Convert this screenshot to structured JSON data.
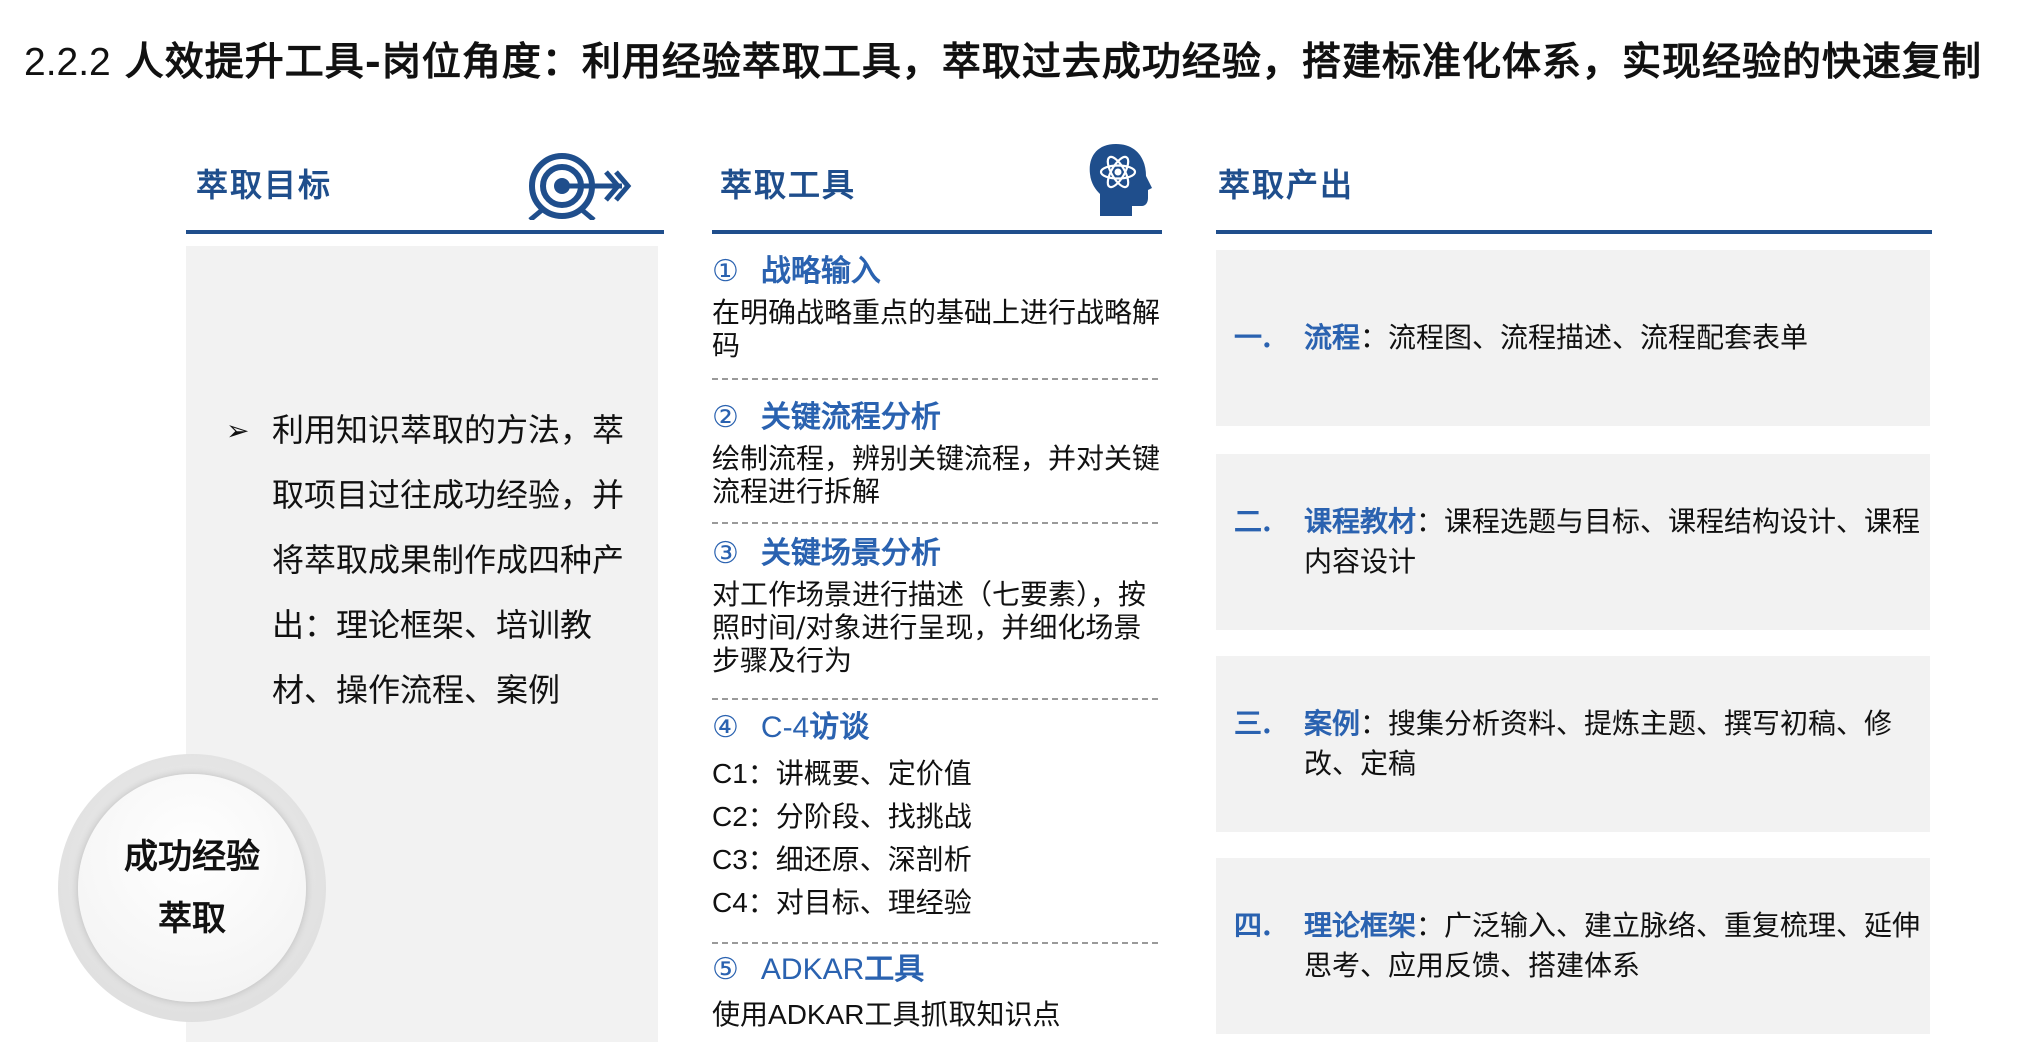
{
  "title": {
    "number": "2.2.2",
    "text": "人效提升工具-岗位角度：利用经验萃取工具，萃取过去成功经验，搭建标准化体系，实现经验的快速复制"
  },
  "columns": {
    "goal": {
      "heading": "萃取目标",
      "icon": "target-arrow-icon"
    },
    "tools": {
      "heading": "萃取工具",
      "icon": "brain-atom-icon"
    },
    "outputs": {
      "heading": "萃取产出"
    }
  },
  "goal_panel": {
    "bullet": "➢",
    "text": "利用知识萃取的方法，萃取项目过往成功经验，并将萃取成果制作成四种产出：理论框架、培训教材、操作流程、案例",
    "circle_line1": "成功经验",
    "circle_line2": "萃取"
  },
  "tools": [
    {
      "index": "①",
      "name": "战略输入",
      "desc": "在明确战略重点的基础上进行战略解码"
    },
    {
      "index": "②",
      "name": "关键流程分析",
      "desc": "绘制流程，辨别关键流程，并对关键流程进行拆解"
    },
    {
      "index": "③",
      "name": "关键场景分析",
      "desc": "对工作场景进行描述（七要素），按照时间/对象进行呈现，并细化场景步骤及行为"
    },
    {
      "index": "④",
      "name_latin": "C-4",
      "name": "访谈",
      "lines": [
        {
          "code": "C1",
          "text": "：讲概要、定价值"
        },
        {
          "code": "C2",
          "text": "：分阶段、找挑战"
        },
        {
          "code": "C3",
          "text": "：细还原、深剖析"
        },
        {
          "code": "C4",
          "text": "：对目标、理经验"
        }
      ]
    },
    {
      "index": "⑤",
      "name_latin": "ADKAR",
      "name": "工具",
      "desc_prefix": "使用",
      "desc_latin": "ADKAR",
      "desc_suffix": "工具抓取知识点"
    }
  ],
  "outputs": [
    {
      "no": "一.",
      "label": "流程",
      "text": "：流程图、流程描述、流程配套表单"
    },
    {
      "no": "二.",
      "label": "课程教材",
      "text": "：课程选题与目标、课程结构设计、课程内容设计"
    },
    {
      "no": "三.",
      "label": "案例",
      "text": "：搜集分析资料、提炼主题、撰写初稿、修改、定稿"
    },
    {
      "no": "四.",
      "label": "理论框架",
      "text": "：广泛输入、建立脉络、重复梳理、延伸思考、应用反馈、搭建体系"
    }
  ],
  "colors": {
    "accent": "#1f4e8c",
    "accent_text": "#2a62b0",
    "panel_bg": "#f2f2f2"
  }
}
